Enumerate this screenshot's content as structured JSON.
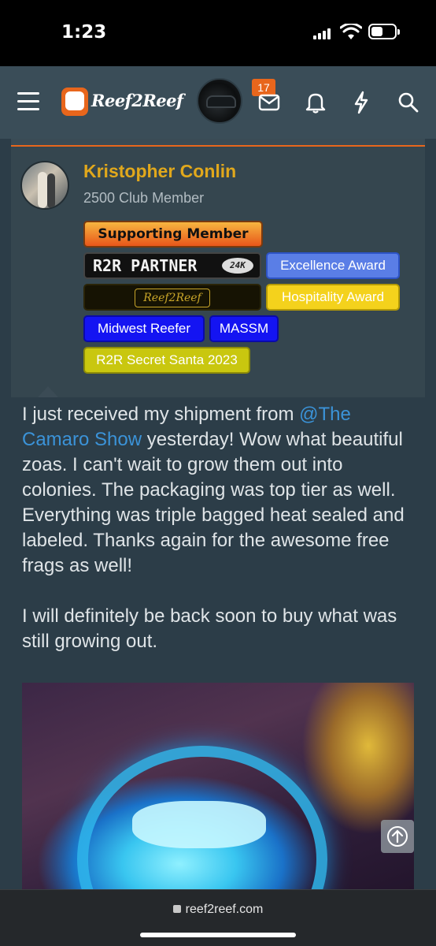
{
  "status_bar": {
    "time": "1:23"
  },
  "nav": {
    "logo_text": "Reef2Reef",
    "message_count": "17"
  },
  "post": {
    "author": {
      "name": "Kristopher Conlin",
      "title": "2500 Club Member"
    },
    "badges": {
      "supporting": "Supporting Member",
      "partner": "R2R PARTNER",
      "partner_level": "24K",
      "reef_logo": "Reef2Reef",
      "excellence": "Excellence Award",
      "hospitality": "Hospitality Award",
      "midwest": "Midwest Reefer",
      "massm": "MASSM",
      "santa": "R2R Secret Santa 2023"
    },
    "body": {
      "p1_before": "I just received my shipment from ",
      "mention": "@The Camaro Show",
      "p1_after": " yesterday! Wow what beautiful zoas. I can't wait to grow them out into colonies. The packaging was top tier as well. Everything was triple bagged heat sealed and labeled. Thanks again for the awesome free frags as well!",
      "p2": "I will definitely be back soon to buy what was still growing out."
    }
  },
  "browser": {
    "url": "reef2reef.com"
  },
  "colors": {
    "accent": "#e8661c",
    "name": "#e1a81c",
    "link": "#3b93d8",
    "background": "#2c3d48"
  }
}
